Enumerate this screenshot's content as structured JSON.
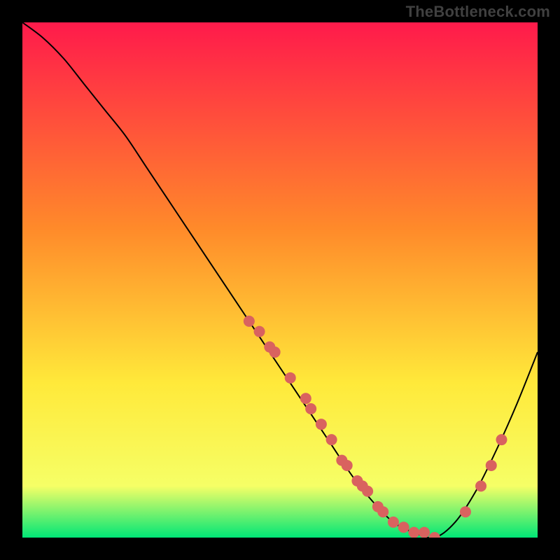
{
  "watermark": "TheBottleneck.com",
  "gradient": {
    "top": "#ff1a4b",
    "mid1": "#ff8a2a",
    "mid2": "#ffe93a",
    "low": "#f6ff66",
    "bottom": "#00e676"
  },
  "chart_data": {
    "type": "line",
    "title": "",
    "xlabel": "",
    "ylabel": "",
    "xlim": [
      0,
      100
    ],
    "ylim": [
      0,
      100
    ],
    "series": [
      {
        "name": "bottleneck-curve",
        "x": [
          0,
          4,
          8,
          12,
          16,
          20,
          24,
          28,
          32,
          36,
          40,
          44,
          48,
          52,
          56,
          60,
          64,
          68,
          72,
          76,
          80,
          84,
          88,
          92,
          96,
          100
        ],
        "values": [
          100,
          97,
          93,
          88,
          83,
          78,
          72,
          66,
          60,
          54,
          48,
          42,
          36,
          30,
          24,
          18,
          12,
          7,
          3,
          1,
          0,
          3,
          9,
          17,
          26,
          36
        ]
      }
    ],
    "points": {
      "name": "sample-markers",
      "x": [
        44,
        46,
        48,
        49,
        52,
        55,
        56,
        58,
        60,
        62,
        63,
        65,
        66,
        67,
        69,
        70,
        72,
        74,
        76,
        78,
        80,
        86,
        89,
        91,
        93
      ],
      "values": [
        42,
        40,
        37,
        36,
        31,
        27,
        25,
        22,
        19,
        15,
        14,
        11,
        10,
        9,
        6,
        5,
        3,
        2,
        1,
        1,
        0,
        5,
        10,
        14,
        19
      ]
    },
    "point_color": "#d9625f",
    "point_radius": 8,
    "curve_color": "#000000",
    "curve_width": 2
  }
}
